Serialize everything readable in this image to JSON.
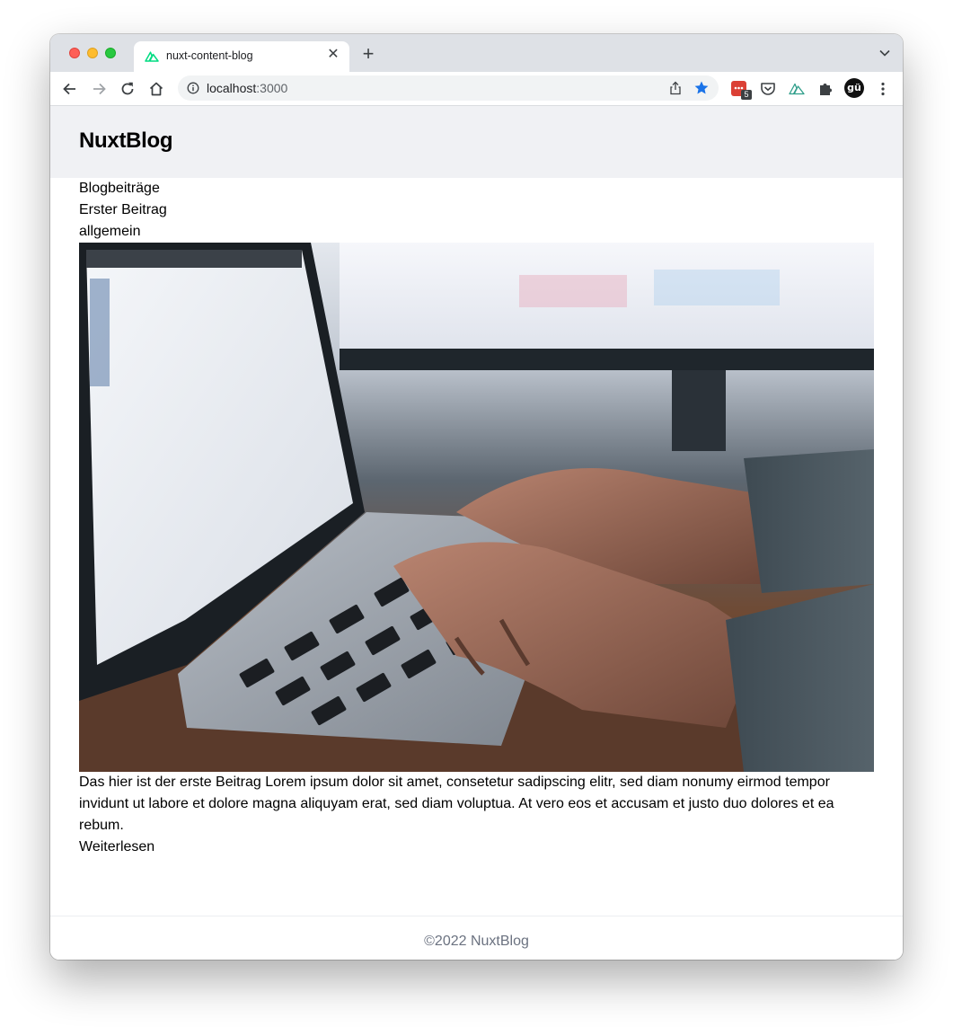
{
  "browser": {
    "tab": {
      "title": "nuxt-content-blog",
      "close_glyph": "✕",
      "favicon": "nuxt-logo-icon"
    },
    "new_tab_glyph": "+",
    "address": {
      "host": "localhost",
      "port": ":3000"
    },
    "extensions": [
      {
        "name": "todoist-extension-icon",
        "badge": "5",
        "color": "#db4035"
      },
      {
        "name": "pocket-extension-icon"
      },
      {
        "name": "nuxt-devtools-extension-icon"
      },
      {
        "name": "puzzle-extensions-icon"
      }
    ],
    "profile_initials": "gü",
    "accent_star_color": "#1a73e8"
  },
  "site": {
    "logo": "NuxtBlog",
    "section_title": "Blogbeiträge",
    "post": {
      "title": "Erster Beitrag",
      "category": "allgemein",
      "image": "laptop-typing-photo",
      "excerpt": "Das hier ist der erste Beitrag Lorem ipsum dolor sit amet, consetetur sadipscing elitr, sed diam nonumy eirmod tempor invidunt ut labore et dolore magna aliquyam erat, sed diam voluptua. At vero eos et accusam et justo duo dolores et ea rebum.",
      "read_more": "Weiterlesen"
    },
    "footer": "©2022 NuxtBlog"
  }
}
